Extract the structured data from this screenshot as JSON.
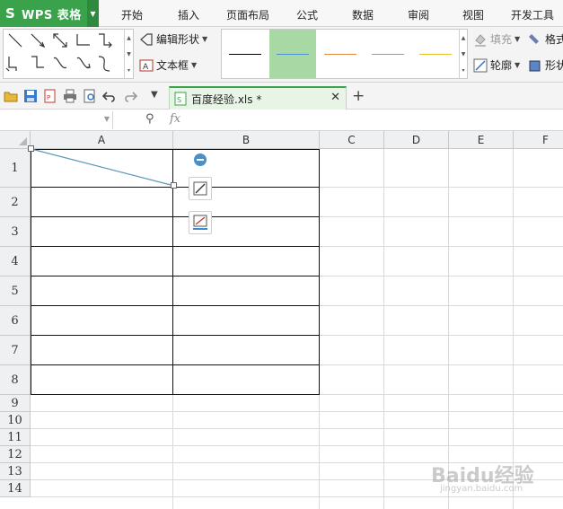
{
  "app": {
    "title": "WPS 表格",
    "logo": "S"
  },
  "menu": [
    "开始",
    "插入",
    "页面布局",
    "公式",
    "数据",
    "审阅",
    "视图",
    "开发工具"
  ],
  "ribbon": {
    "edit_shape": "编辑形状",
    "text_box": "文本框",
    "fill": "填充",
    "outline": "轮廓",
    "format": "格式",
    "shape_effects": "形状"
  },
  "style_colors": [
    "#000000",
    "#4a8fd0",
    "#e8893a",
    "#9a9a9a",
    "#e8c030"
  ],
  "document": {
    "tab_name": "百度经验.xls *"
  },
  "formula_bar": {
    "name_box": "",
    "fx": "fx"
  },
  "columns": [
    "A",
    "B",
    "C",
    "D",
    "E",
    "F"
  ],
  "rows": [
    "1",
    "2",
    "3",
    "4",
    "5",
    "6",
    "7",
    "8",
    "9",
    "10",
    "11",
    "12",
    "13",
    "14"
  ],
  "colors": {
    "accent": "#3aa24a",
    "diagonal_line": "#5b9bb8"
  },
  "watermark": {
    "brand": "Baidu经验",
    "url": "jingyan.baidu.com"
  }
}
